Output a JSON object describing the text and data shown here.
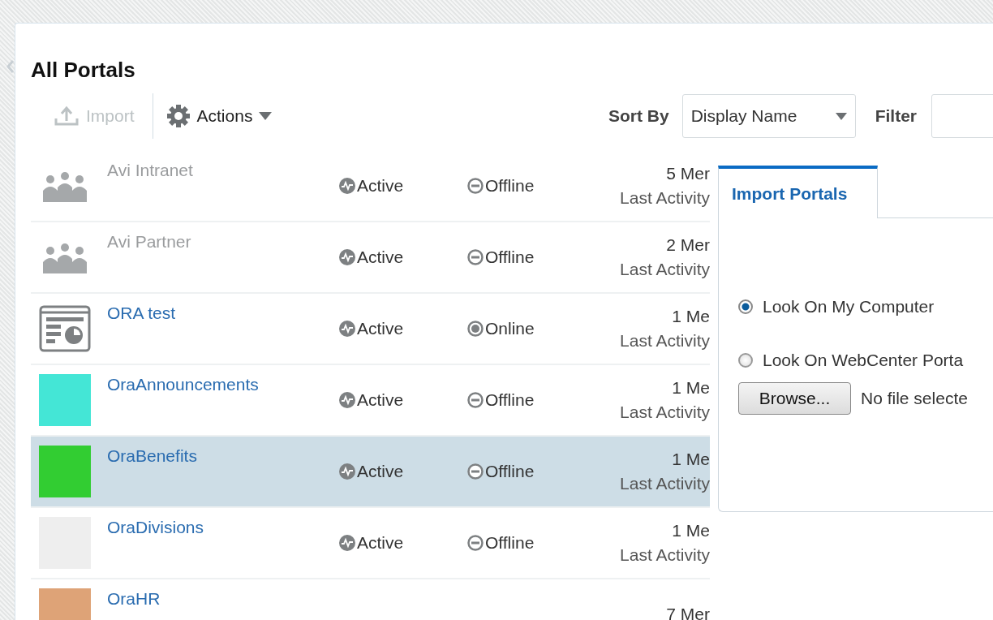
{
  "page": {
    "title": "All Portals"
  },
  "toolbar": {
    "import": {
      "label": "Import",
      "disabled": true
    },
    "actions": {
      "label": "Actions"
    },
    "sort_label": "Sort By",
    "sort_value": "Display Name",
    "filter_label": "Filter"
  },
  "portals": [
    {
      "name": "Avi Intranet",
      "kind": "people",
      "disabled": true,
      "state": "Active",
      "status": "Offline",
      "online": false,
      "members": "5 Mer",
      "activity": "Last Activity",
      "selected": false
    },
    {
      "name": "Avi Partner",
      "kind": "people",
      "disabled": true,
      "state": "Active",
      "status": "Offline",
      "online": false,
      "members": "2 Mer",
      "activity": "Last Activity",
      "selected": false
    },
    {
      "name": "ORA test",
      "kind": "template",
      "disabled": false,
      "state": "Active",
      "status": "Online",
      "online": true,
      "members": "1 Me",
      "activity": "Last Activity",
      "selected": false
    },
    {
      "name": "OraAnnouncements",
      "kind": "swatch",
      "color": "#44e6d6",
      "disabled": false,
      "state": "Active",
      "status": "Offline",
      "online": false,
      "members": "1 Me",
      "activity": "Last Activity",
      "selected": false
    },
    {
      "name": "OraBenefits",
      "kind": "swatch",
      "color": "#32cd32",
      "disabled": false,
      "state": "Active",
      "status": "Offline",
      "online": false,
      "members": "1 Me",
      "activity": "Last Activity",
      "selected": true
    },
    {
      "name": "OraDivisions",
      "kind": "swatch",
      "color": "#eeeeee",
      "disabled": false,
      "state": "Active",
      "status": "Offline",
      "online": false,
      "members": "1 Me",
      "activity": "Last Activity",
      "selected": false
    },
    {
      "name": "OraHR",
      "kind": "swatch",
      "color": "#dea377",
      "disabled": false,
      "members": "7 Mer",
      "selected": false
    }
  ],
  "import_panel": {
    "tabs": [
      {
        "label": "Import Portals",
        "selected": true
      }
    ],
    "options": [
      {
        "label": "Look On My Computer",
        "selected": true
      },
      {
        "label": "Look On WebCenter Porta",
        "selected": false
      }
    ],
    "browse": "Browse...",
    "file": "No file selecte"
  }
}
